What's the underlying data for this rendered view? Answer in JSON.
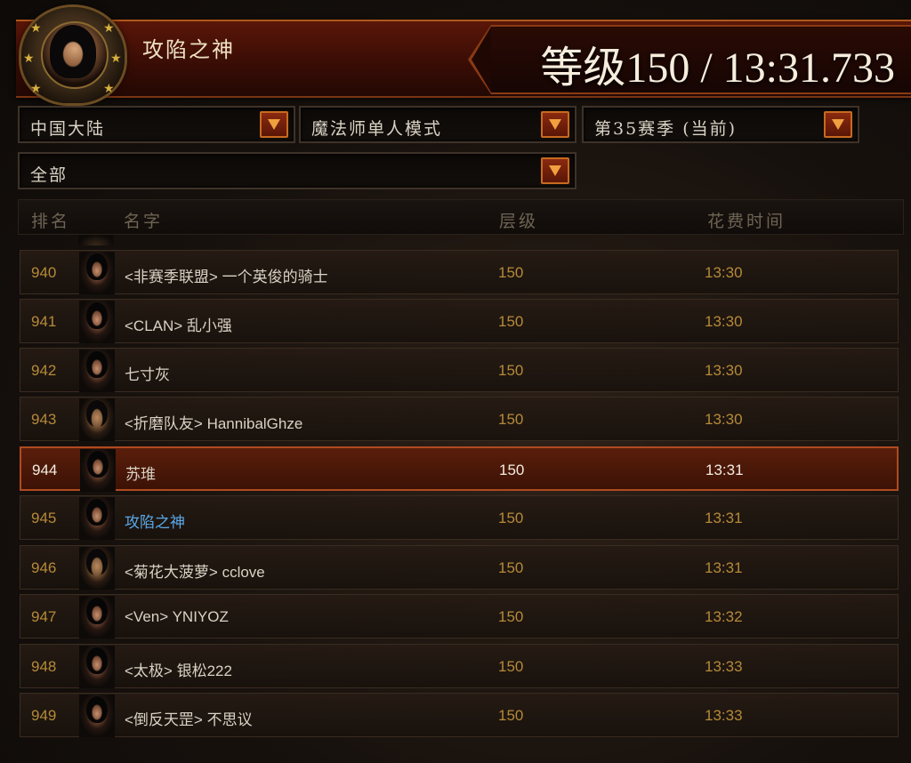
{
  "header": {
    "player_name": "攻陷之神",
    "rank_summary": "等级150 / 13:31.733"
  },
  "filters": {
    "region": "中国大陆",
    "mode": "魔法师单人模式",
    "season": "第35赛季 (当前)",
    "category": "全部"
  },
  "table": {
    "columns": [
      "排名",
      "名字",
      "层级",
      "花费时间"
    ],
    "rows": [
      {
        "rank": "940",
        "name": "<非赛季联盟> 一个英俊的骑士",
        "tier": "150",
        "time": "13:30",
        "avatar": "female-wizard-portrait"
      },
      {
        "rank": "941",
        "name": "<CLAN> 乱小强",
        "tier": "150",
        "time": "13:30",
        "avatar": "female-wizard-portrait"
      },
      {
        "rank": "942",
        "name": "七寸灰",
        "tier": "150",
        "time": "13:30",
        "avatar": "female-wizard-portrait"
      },
      {
        "rank": "943",
        "name": "<折磨队友> HannibalGhze",
        "tier": "150",
        "time": "13:30",
        "avatar": "male-wizard-portrait"
      },
      {
        "rank": "944",
        "name": "苏琟",
        "tier": "150",
        "time": "13:31",
        "avatar": "female-wizard-portrait"
      },
      {
        "rank": "945",
        "name": "攻陷之神",
        "tier": "150",
        "time": "13:31",
        "avatar": "female-wizard-portrait"
      },
      {
        "rank": "946",
        "name": "<菊花大菠萝> cclove",
        "tier": "150",
        "time": "13:31",
        "avatar": "male-wizard-portrait"
      },
      {
        "rank": "947",
        "name": "<Ven> YNIYOZ",
        "tier": "150",
        "time": "13:32",
        "avatar": "female-wizard-portrait"
      },
      {
        "rank": "948",
        "name": "<太极> 银松222",
        "tier": "150",
        "time": "13:33",
        "avatar": "female-wizard-portrait"
      },
      {
        "rank": "949",
        "name": "<倒反天罡> 不思议",
        "tier": "150",
        "time": "13:33",
        "avatar": "female-wizard-portrait"
      }
    ]
  },
  "colors": {
    "accent": "#b04a20",
    "self_name": "#5aa8e8",
    "rank_text": "#b58a38"
  }
}
